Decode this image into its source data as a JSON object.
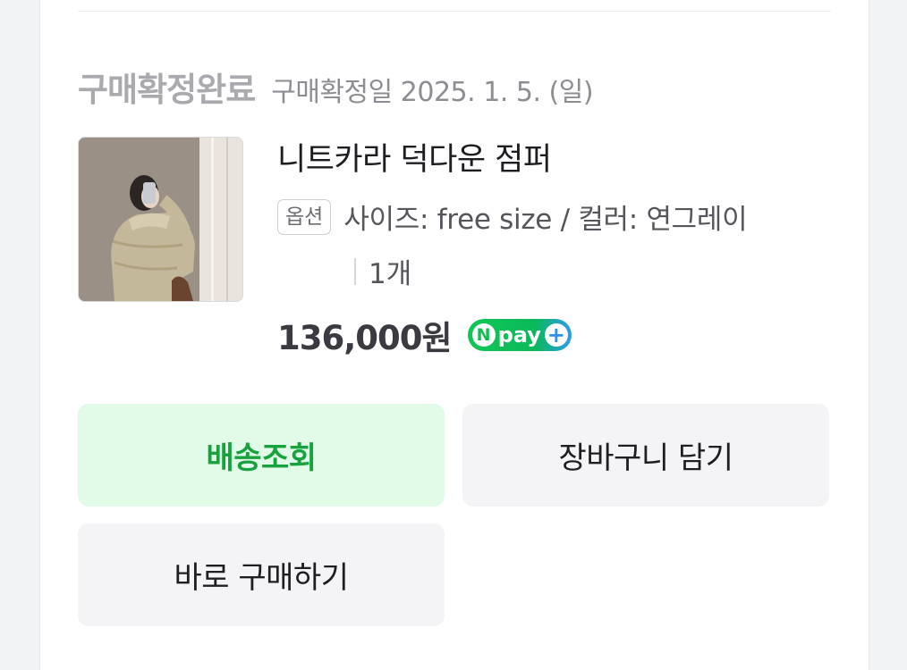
{
  "order": {
    "status": "구매확정완료",
    "confirm_date": "구매확정일 2025. 1. 5. (일)"
  },
  "product": {
    "thumbnail_icon": "product-photo",
    "name": "니트카라 덕다운 점퍼",
    "option_label": "옵션",
    "option_text": "사이즈: free size / 컬러: 연그레이",
    "quantity": "1개",
    "price": "136,000원",
    "npay": {
      "n": "N",
      "text": "pay",
      "plus": "+"
    }
  },
  "actions": {
    "delivery": "배송조회",
    "cart": "장바구니 담기",
    "buy_now": "바로 구매하기"
  },
  "colors": {
    "delivery_bg": "#e1fbe8",
    "delivery_text": "#17a23d",
    "npay_green": "#10c855",
    "npay_blue": "#2f9bf0"
  }
}
